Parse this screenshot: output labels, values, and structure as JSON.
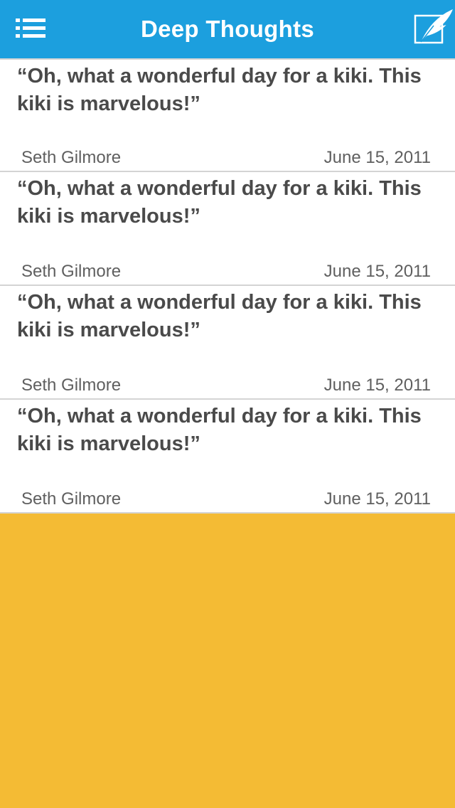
{
  "navbar": {
    "title": "Deep Thoughts",
    "menu_icon": "list-menu-icon",
    "compose_icon": "quill-compose-icon",
    "background_color": "#1c9fde"
  },
  "quotes": [
    {
      "text": "“Oh, what a wonderful day for a kiki. This kiki is marvelous!”",
      "author": "Seth Gilmore",
      "date": "June 15, 2011"
    },
    {
      "text": "“Oh, what a wonderful day for a kiki. This kiki is marvelous!”",
      "author": "Seth Gilmore",
      "date": "June 15, 2011"
    },
    {
      "text": "“Oh, what a wonderful day for a kiki. This kiki is marvelous!”",
      "author": "Seth Gilmore",
      "date": "June 15, 2011"
    },
    {
      "text": "“Oh, what a wonderful day for a kiki. This kiki is marvelous!”",
      "author": "Seth Gilmore",
      "date": "June 15, 2011"
    }
  ],
  "colors": {
    "accent_blue": "#1c9fde",
    "panel_yellow": "#f4bb34",
    "text_gray": "#4a4a4a"
  }
}
